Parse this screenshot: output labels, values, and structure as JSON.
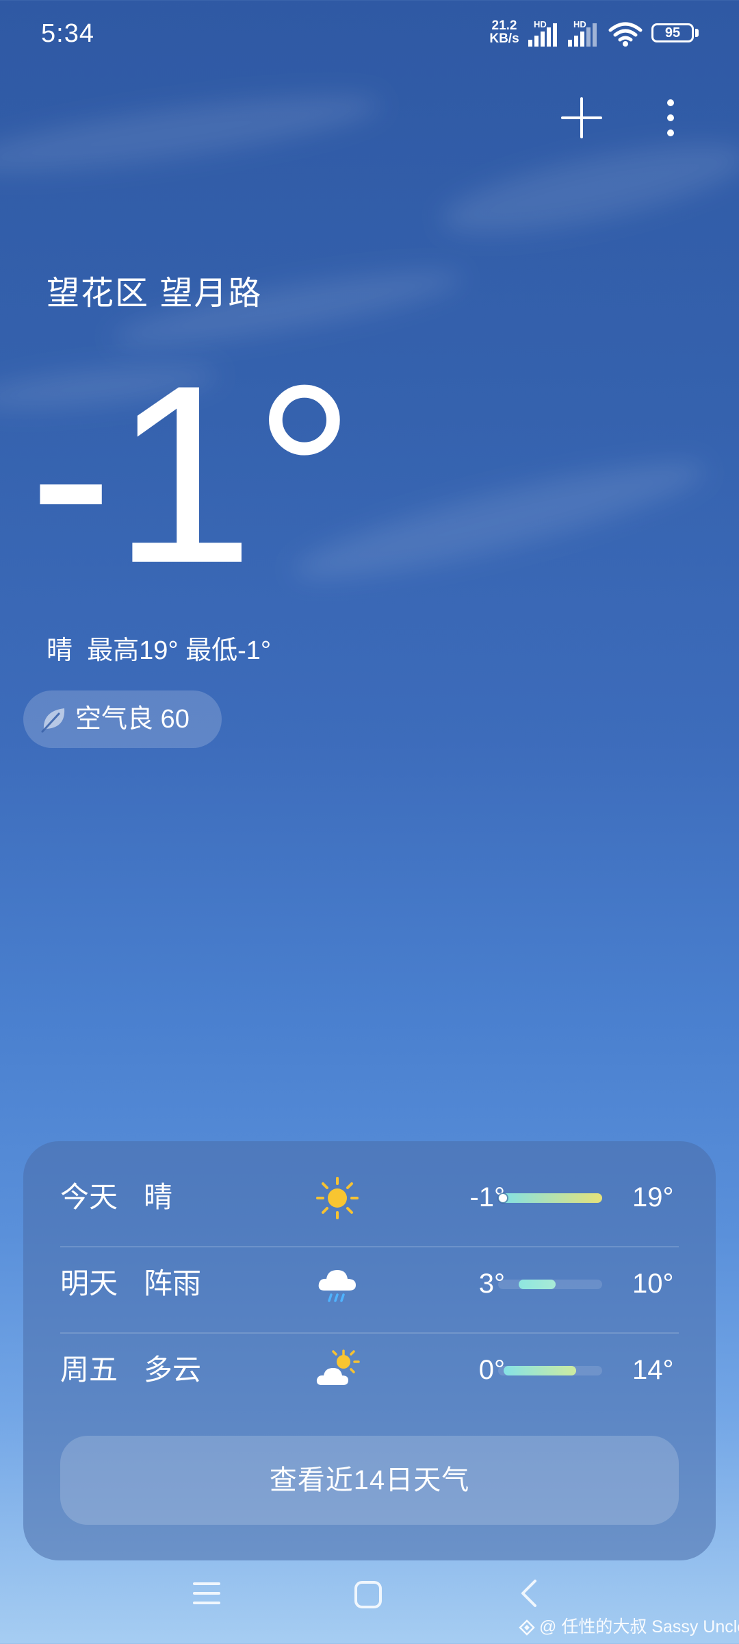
{
  "status_bar": {
    "time": "5:34",
    "net_speed_value": "21.2",
    "net_speed_unit": "KB/s",
    "sim1_tag": "HD",
    "sim2_tag": "HD",
    "battery": "95"
  },
  "top_actions": {
    "add_icon": "plus-icon",
    "more_icon": "more-vertical-icon"
  },
  "current": {
    "location": "望花区 望月路",
    "temperature": "-1°",
    "summary": "晴  最高19° 最低-1°",
    "aqi": {
      "label": "空气良 60",
      "icon": "leaf-icon"
    }
  },
  "forecast": {
    "scale_min": -1,
    "scale_max": 19,
    "current_temp": -1,
    "rows": [
      {
        "day": "今天",
        "condition": "晴",
        "icon": "sun-icon",
        "low": "-1°",
        "high": "19°",
        "low_value": -1,
        "high_value": 19,
        "bar_colors": [
          "#7fe1e8",
          "#e6e27a"
        ]
      },
      {
        "day": "明天",
        "condition": "阵雨",
        "icon": "rain-cloud-icon",
        "low": "3°",
        "high": "10°",
        "low_value": 3,
        "high_value": 10,
        "bar_colors": [
          "#8ee6df",
          "#a8ead6"
        ]
      },
      {
        "day": "周五",
        "condition": "多云",
        "icon": "partly-cloudy-icon",
        "low": "0°",
        "high": "14°",
        "low_value": 0,
        "high_value": 14,
        "bar_colors": [
          "#86e2e6",
          "#cdeba0"
        ]
      }
    ],
    "view_more": "查看近14日天气"
  },
  "nav_bar": {
    "menu_icon": "menu-icon",
    "home_icon": "home-square-icon",
    "back_icon": "back-chevron-icon"
  },
  "watermark": "@ 任性的大叔 Sassy Uncle"
}
